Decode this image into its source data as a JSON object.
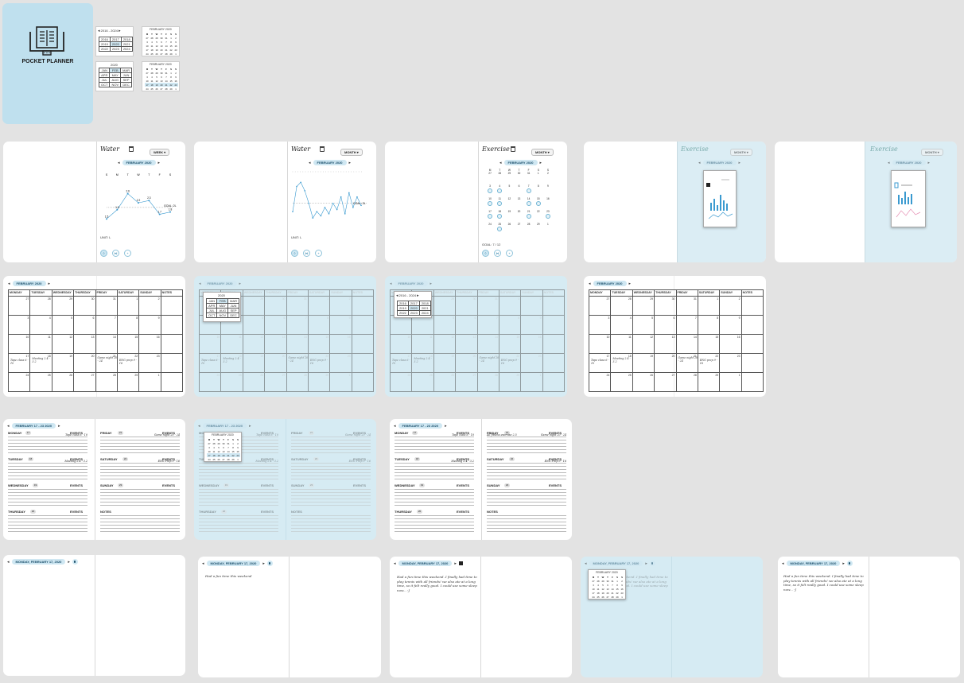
{
  "app": {
    "name": "POCKET PLANNER",
    "icon": "open-book-planner-icon"
  },
  "colors": {
    "accent": "#cfe7f2",
    "panel": "#bfe0ee",
    "background": "#e3e3e3"
  },
  "year_picker": {
    "range": "2016 - 2024",
    "years": [
      "2016",
      "2017",
      "2018",
      "2019",
      "2020",
      "2021",
      "2022",
      "2023",
      "2024"
    ],
    "selected": "2020"
  },
  "month_picker": {
    "year": "2020",
    "months": [
      "JAN",
      "FEB",
      "MAR",
      "APR",
      "MAY",
      "JUN",
      "JUL",
      "AUG",
      "SEP",
      "OCT",
      "NOV",
      "DEC"
    ],
    "selected": "FEB"
  },
  "mini_cal": {
    "title": "FEBRUARY 2020",
    "dow": [
      "M",
      "T",
      "W",
      "T",
      "F",
      "S",
      "S"
    ]
  },
  "trackers": {
    "water_week": {
      "title": "Water",
      "period": "WEEK",
      "range": "FEBRUARY 2020",
      "days": [
        "S",
        "M",
        "T",
        "W",
        "T",
        "F",
        "S"
      ],
      "values": [
        1.5,
        1.9,
        2.6,
        2.2,
        2.3,
        1.7,
        1.8
      ],
      "goal_label": "GOAL: 2L",
      "unit": "UNIT: L"
    },
    "water_month": {
      "title": "Water",
      "period": "MONTH",
      "range": "FEBRUARY 2020",
      "goal_label": "GOAL: 2L",
      "unit": "UNIT: L"
    },
    "exercise_month": {
      "title": "Exercise",
      "period": "MONTH",
      "range": "FEBRUARY 2020",
      "goal_label": "GOAL: 7 / 12"
    },
    "exercise_popup": {
      "title": "Exercise",
      "period": "MONTH",
      "range": "FEBRUARY 2020"
    }
  },
  "monthly": {
    "nav": "FEBRUARY 2020",
    "headers": [
      "MONDAY",
      "TUESDAY",
      "WEDNESDAY",
      "THURSDAY",
      "FRIDAY",
      "SATURDAY",
      "SUNDAY",
      "NOTES"
    ],
    "weeks": [
      [
        "27",
        "28",
        "29",
        "30",
        "31",
        "1",
        "2"
      ],
      [
        "3",
        "4",
        "5",
        "6",
        "7",
        "8",
        "9"
      ],
      [
        "10",
        "11",
        "12",
        "13",
        "14",
        "15",
        "16"
      ],
      [
        "17",
        "18",
        "19",
        "20",
        "21",
        "22",
        "23"
      ],
      [
        "24",
        "25",
        "26",
        "27",
        "28",
        "29",
        "1"
      ]
    ],
    "events": {
      "mon17": "Tape class 6 - 10",
      "tue18": "Meeting 2.4 - 3.2",
      "fri21": "Game night 20 - 24",
      "sat22": "ENG prep 9 - 16"
    }
  },
  "weekly": {
    "nav": "FEBRUARY 17 - 23 2020",
    "days": [
      {
        "name": "MONDAY",
        "num": "17",
        "event": "Tape class 6 - 10"
      },
      {
        "name": "TUESDAY",
        "num": "18",
        "event": "Meeting 2.4 - 3.2"
      },
      {
        "name": "WEDNESDAY",
        "num": "19",
        "event": ""
      },
      {
        "name": "THURSDAY",
        "num": "20",
        "event": ""
      },
      {
        "name": "FRIDAY",
        "num": "21",
        "event": "Game night 20 - 24"
      },
      {
        "name": "SATURDAY",
        "num": "22",
        "event": "ENG Prep 9 - 16"
      },
      {
        "name": "SUNDAY",
        "num": "23",
        "event": ""
      }
    ],
    "events_label": "EVENTS",
    "notes_label": "NOTES",
    "friday_extra": "All fitness exercise 2.5"
  },
  "daily": {
    "nav": "MONDAY, FEBRUARY 17, 2020",
    "short_note": "Had a fun time this weekend",
    "long_note": "Had a fun time this weekend. I finally had time to play tennis with all friends! we also ate at a long time, so it felt really good. I could use some sleep now... -J"
  }
}
